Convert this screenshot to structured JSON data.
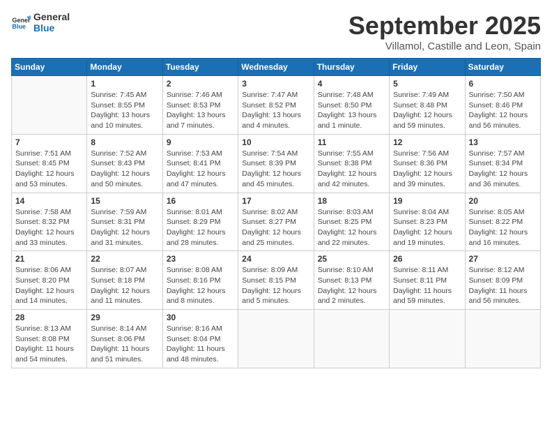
{
  "header": {
    "logo_line1": "General",
    "logo_line2": "Blue",
    "title": "September 2025",
    "subtitle": "Villamol, Castille and Leon, Spain"
  },
  "weekdays": [
    "Sunday",
    "Monday",
    "Tuesday",
    "Wednesday",
    "Thursday",
    "Friday",
    "Saturday"
  ],
  "weeks": [
    [
      {
        "day": "",
        "content": ""
      },
      {
        "day": "1",
        "content": "Sunrise: 7:45 AM\nSunset: 8:55 PM\nDaylight: 13 hours\nand 10 minutes."
      },
      {
        "day": "2",
        "content": "Sunrise: 7:46 AM\nSunset: 8:53 PM\nDaylight: 13 hours\nand 7 minutes."
      },
      {
        "day": "3",
        "content": "Sunrise: 7:47 AM\nSunset: 8:52 PM\nDaylight: 13 hours\nand 4 minutes."
      },
      {
        "day": "4",
        "content": "Sunrise: 7:48 AM\nSunset: 8:50 PM\nDaylight: 13 hours\nand 1 minute."
      },
      {
        "day": "5",
        "content": "Sunrise: 7:49 AM\nSunset: 8:48 PM\nDaylight: 12 hours\nand 59 minutes."
      },
      {
        "day": "6",
        "content": "Sunrise: 7:50 AM\nSunset: 8:46 PM\nDaylight: 12 hours\nand 56 minutes."
      }
    ],
    [
      {
        "day": "7",
        "content": "Sunrise: 7:51 AM\nSunset: 8:45 PM\nDaylight: 12 hours\nand 53 minutes."
      },
      {
        "day": "8",
        "content": "Sunrise: 7:52 AM\nSunset: 8:43 PM\nDaylight: 12 hours\nand 50 minutes."
      },
      {
        "day": "9",
        "content": "Sunrise: 7:53 AM\nSunset: 8:41 PM\nDaylight: 12 hours\nand 47 minutes."
      },
      {
        "day": "10",
        "content": "Sunrise: 7:54 AM\nSunset: 8:39 PM\nDaylight: 12 hours\nand 45 minutes."
      },
      {
        "day": "11",
        "content": "Sunrise: 7:55 AM\nSunset: 8:38 PM\nDaylight: 12 hours\nand 42 minutes."
      },
      {
        "day": "12",
        "content": "Sunrise: 7:56 AM\nSunset: 8:36 PM\nDaylight: 12 hours\nand 39 minutes."
      },
      {
        "day": "13",
        "content": "Sunrise: 7:57 AM\nSunset: 8:34 PM\nDaylight: 12 hours\nand 36 minutes."
      }
    ],
    [
      {
        "day": "14",
        "content": "Sunrise: 7:58 AM\nSunset: 8:32 PM\nDaylight: 12 hours\nand 33 minutes."
      },
      {
        "day": "15",
        "content": "Sunrise: 7:59 AM\nSunset: 8:31 PM\nDaylight: 12 hours\nand 31 minutes."
      },
      {
        "day": "16",
        "content": "Sunrise: 8:01 AM\nSunset: 8:29 PM\nDaylight: 12 hours\nand 28 minutes."
      },
      {
        "day": "17",
        "content": "Sunrise: 8:02 AM\nSunset: 8:27 PM\nDaylight: 12 hours\nand 25 minutes."
      },
      {
        "day": "18",
        "content": "Sunrise: 8:03 AM\nSunset: 8:25 PM\nDaylight: 12 hours\nand 22 minutes."
      },
      {
        "day": "19",
        "content": "Sunrise: 8:04 AM\nSunset: 8:23 PM\nDaylight: 12 hours\nand 19 minutes."
      },
      {
        "day": "20",
        "content": "Sunrise: 8:05 AM\nSunset: 8:22 PM\nDaylight: 12 hours\nand 16 minutes."
      }
    ],
    [
      {
        "day": "21",
        "content": "Sunrise: 8:06 AM\nSunset: 8:20 PM\nDaylight: 12 hours\nand 14 minutes."
      },
      {
        "day": "22",
        "content": "Sunrise: 8:07 AM\nSunset: 8:18 PM\nDaylight: 12 hours\nand 11 minutes."
      },
      {
        "day": "23",
        "content": "Sunrise: 8:08 AM\nSunset: 8:16 PM\nDaylight: 12 hours\nand 8 minutes."
      },
      {
        "day": "24",
        "content": "Sunrise: 8:09 AM\nSunset: 8:15 PM\nDaylight: 12 hours\nand 5 minutes."
      },
      {
        "day": "25",
        "content": "Sunrise: 8:10 AM\nSunset: 8:13 PM\nDaylight: 12 hours\nand 2 minutes."
      },
      {
        "day": "26",
        "content": "Sunrise: 8:11 AM\nSunset: 8:11 PM\nDaylight: 11 hours\nand 59 minutes."
      },
      {
        "day": "27",
        "content": "Sunrise: 8:12 AM\nSunset: 8:09 PM\nDaylight: 11 hours\nand 56 minutes."
      }
    ],
    [
      {
        "day": "28",
        "content": "Sunrise: 8:13 AM\nSunset: 8:08 PM\nDaylight: 11 hours\nand 54 minutes."
      },
      {
        "day": "29",
        "content": "Sunrise: 8:14 AM\nSunset: 8:06 PM\nDaylight: 11 hours\nand 51 minutes."
      },
      {
        "day": "30",
        "content": "Sunrise: 8:16 AM\nSunset: 8:04 PM\nDaylight: 11 hours\nand 48 minutes."
      },
      {
        "day": "",
        "content": ""
      },
      {
        "day": "",
        "content": ""
      },
      {
        "day": "",
        "content": ""
      },
      {
        "day": "",
        "content": ""
      }
    ]
  ]
}
